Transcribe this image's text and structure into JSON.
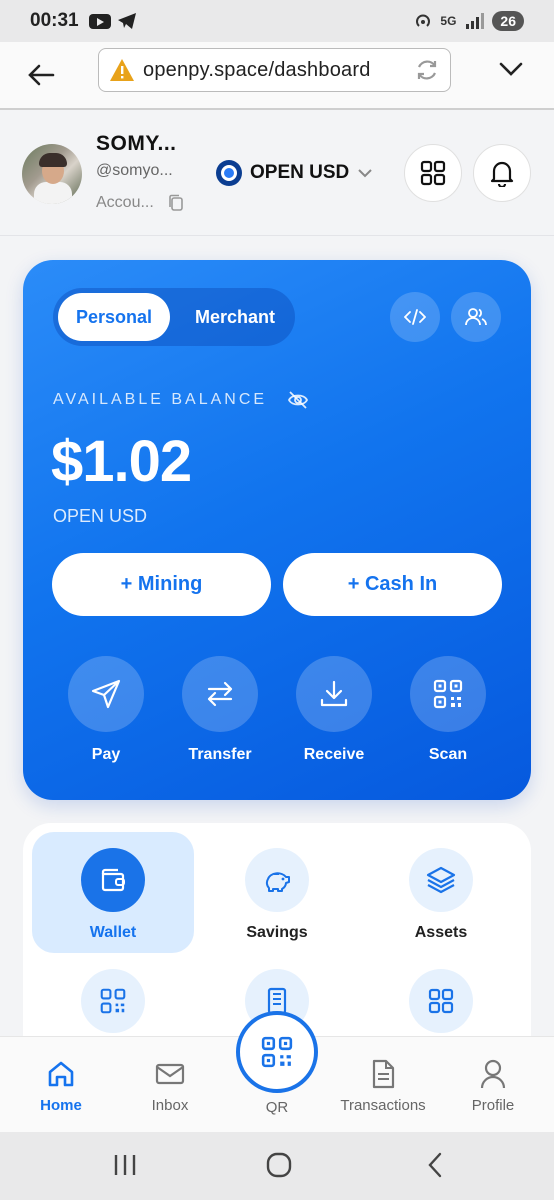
{
  "status_bar": {
    "time": "00:31",
    "network": "5G",
    "battery": "26"
  },
  "browser": {
    "url": "openpy.space/dashboard"
  },
  "header": {
    "name": "SOMY...",
    "handle": "@somyo...",
    "account": "Accou...",
    "currency": "OPEN USD"
  },
  "card": {
    "tabs": [
      "Personal",
      "Merchant"
    ],
    "balance_label": "AVAILABLE BALANCE",
    "balance": "$1.02",
    "balance_currency": "OPEN USD",
    "buttons": [
      "+ Mining",
      "+ Cash In"
    ],
    "actions": [
      {
        "label": "Pay",
        "icon": "send-icon"
      },
      {
        "label": "Transfer",
        "icon": "transfer-icon"
      },
      {
        "label": "Receive",
        "icon": "download-icon"
      },
      {
        "label": "Scan",
        "icon": "qr-scan-icon"
      }
    ]
  },
  "grid": {
    "tiles": [
      {
        "label": "Wallet",
        "icon": "wallet-icon",
        "active": true
      },
      {
        "label": "Savings",
        "icon": "piggy-bank-icon",
        "active": false
      },
      {
        "label": "Assets",
        "icon": "layers-icon",
        "active": false
      },
      {
        "label": "",
        "icon": "qr-code-icon",
        "active": false
      },
      {
        "label": "",
        "icon": "building-icon",
        "active": false
      },
      {
        "label": "",
        "icon": "grid-icon",
        "active": false
      }
    ]
  },
  "bottom_nav": {
    "items": [
      "Home",
      "Inbox",
      "QR",
      "Transactions",
      "Profile"
    ],
    "active": "Home"
  },
  "colors": {
    "primary": "#1573ee",
    "card_gradient_start": "#2b8cf8",
    "card_gradient_end": "#0659de",
    "active_tile": "#d9ebff"
  }
}
